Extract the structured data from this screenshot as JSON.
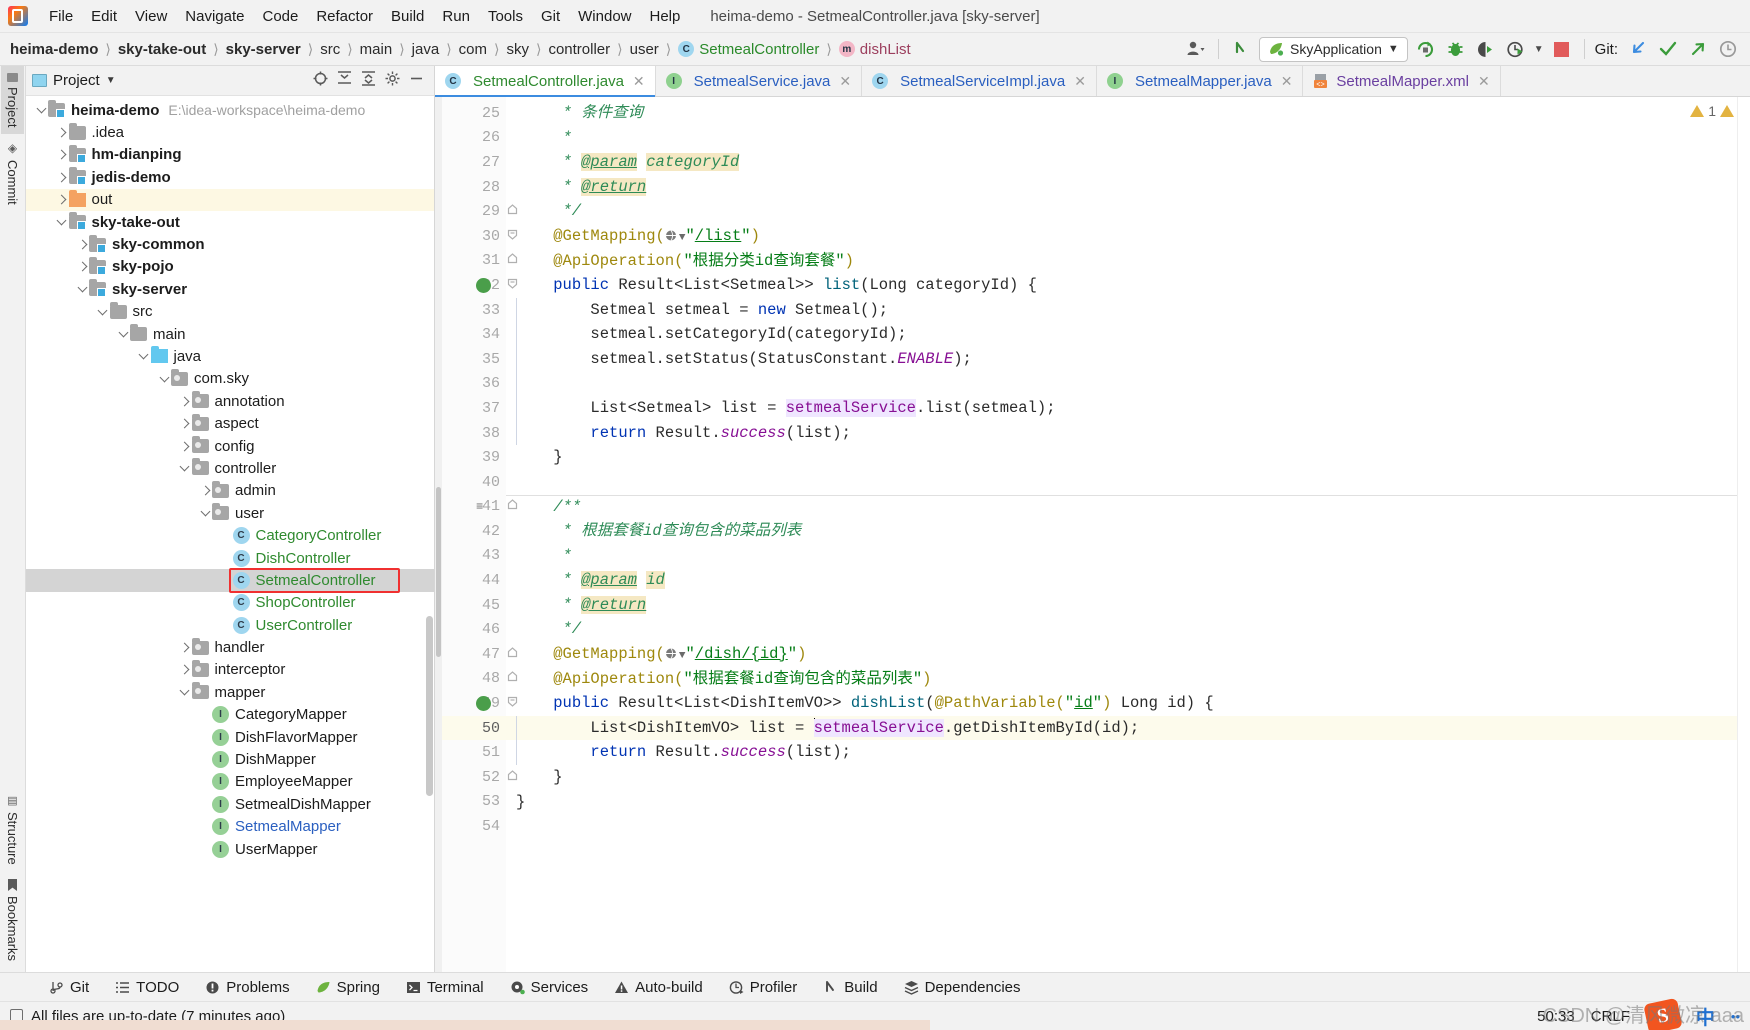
{
  "window": {
    "title": "heima-demo - SetmealController.java [sky-server]"
  },
  "menu": {
    "items": [
      "File",
      "Edit",
      "View",
      "Navigate",
      "Code",
      "Refactor",
      "Build",
      "Run",
      "Tools",
      "Git",
      "Window",
      "Help"
    ]
  },
  "breadcrumb": {
    "items": [
      {
        "label": "heima-demo",
        "bold": true
      },
      {
        "label": "sky-take-out",
        "bold": true
      },
      {
        "label": "sky-server",
        "bold": true
      },
      {
        "label": "src",
        "bold": false
      },
      {
        "label": "main",
        "bold": false
      },
      {
        "label": "java",
        "bold": false
      },
      {
        "label": "com",
        "bold": false
      },
      {
        "label": "sky",
        "bold": false
      },
      {
        "label": "controller",
        "bold": false
      },
      {
        "label": "user",
        "bold": false
      },
      {
        "label": "SetmealController",
        "bold": false,
        "badge": "C",
        "color": "green"
      },
      {
        "label": "dishList",
        "bold": false,
        "badge": "m",
        "color": "pink"
      }
    ]
  },
  "toolbar": {
    "run_config": "SkyApplication",
    "git_label": "Git:",
    "icons": [
      "profiles-icon",
      "back-arrow-icon",
      "run-icon",
      "debug-icon",
      "run-coverage-icon",
      "profiler-run-icon",
      "stop-icon",
      "update-project-icon",
      "commit-icon",
      "push-icon",
      "history-icon"
    ]
  },
  "rail": {
    "top": [
      "Project",
      "Commit"
    ],
    "bottom": [
      "Bookmarks",
      "Structure"
    ]
  },
  "project_panel": {
    "title": "Project",
    "tools": [
      "locate-icon",
      "expand-all-icon",
      "collapse-all-icon",
      "settings-icon",
      "hide-icon"
    ],
    "tree": [
      {
        "depth": 0,
        "label": "heima-demo",
        "path": "E:\\idea-workspace\\heima-demo",
        "icon": "module",
        "twisty": "down",
        "bold": true
      },
      {
        "depth": 1,
        "label": ".idea",
        "icon": "folder",
        "twisty": "right",
        "bold": false
      },
      {
        "depth": 1,
        "label": "hm-dianping",
        "icon": "module",
        "twisty": "right",
        "bold": true
      },
      {
        "depth": 1,
        "label": "jedis-demo",
        "icon": "module",
        "twisty": "right",
        "bold": true
      },
      {
        "depth": 1,
        "label": "out",
        "icon": "folder-orange",
        "twisty": "right",
        "bold": false,
        "highlight": true
      },
      {
        "depth": 1,
        "label": "sky-take-out",
        "icon": "module",
        "twisty": "down",
        "bold": true
      },
      {
        "depth": 2,
        "label": "sky-common",
        "icon": "module",
        "twisty": "right",
        "bold": true
      },
      {
        "depth": 2,
        "label": "sky-pojo",
        "icon": "module",
        "twisty": "right",
        "bold": true
      },
      {
        "depth": 2,
        "label": "sky-server",
        "icon": "module",
        "twisty": "down",
        "bold": true
      },
      {
        "depth": 3,
        "label": "src",
        "icon": "folder",
        "twisty": "down",
        "bold": false
      },
      {
        "depth": 4,
        "label": "main",
        "icon": "folder",
        "twisty": "down",
        "bold": false
      },
      {
        "depth": 5,
        "label": "java",
        "icon": "folder-blue",
        "twisty": "down",
        "bold": false
      },
      {
        "depth": 6,
        "label": "com.sky",
        "icon": "package",
        "twisty": "down",
        "bold": false
      },
      {
        "depth": 7,
        "label": "annotation",
        "icon": "package",
        "twisty": "right",
        "bold": false
      },
      {
        "depth": 7,
        "label": "aspect",
        "icon": "package",
        "twisty": "right",
        "bold": false
      },
      {
        "depth": 7,
        "label": "config",
        "icon": "package",
        "twisty": "right",
        "bold": false
      },
      {
        "depth": 7,
        "label": "controller",
        "icon": "package",
        "twisty": "down",
        "bold": false
      },
      {
        "depth": 8,
        "label": "admin",
        "icon": "package",
        "twisty": "right",
        "bold": false
      },
      {
        "depth": 8,
        "label": "user",
        "icon": "package",
        "twisty": "down",
        "bold": false
      },
      {
        "depth": 9,
        "label": "CategoryController",
        "icon": "class",
        "twisty": "none",
        "bold": false,
        "color": "green"
      },
      {
        "depth": 9,
        "label": "DishController",
        "icon": "class",
        "twisty": "none",
        "bold": false,
        "color": "green"
      },
      {
        "depth": 9,
        "label": "SetmealController",
        "icon": "class",
        "twisty": "none",
        "bold": false,
        "color": "green",
        "selected": true,
        "boxed": true
      },
      {
        "depth": 9,
        "label": "ShopController",
        "icon": "class",
        "twisty": "none",
        "bold": false,
        "color": "green"
      },
      {
        "depth": 9,
        "label": "UserController",
        "icon": "class",
        "twisty": "none",
        "bold": false,
        "color": "green"
      },
      {
        "depth": 7,
        "label": "handler",
        "icon": "package",
        "twisty": "right",
        "bold": false
      },
      {
        "depth": 7,
        "label": "interceptor",
        "icon": "package",
        "twisty": "right",
        "bold": false
      },
      {
        "depth": 7,
        "label": "mapper",
        "icon": "package",
        "twisty": "down",
        "bold": false
      },
      {
        "depth": 8,
        "label": "CategoryMapper",
        "icon": "interface",
        "twisty": "none",
        "bold": false
      },
      {
        "depth": 8,
        "label": "DishFlavorMapper",
        "icon": "interface",
        "twisty": "none",
        "bold": false
      },
      {
        "depth": 8,
        "label": "DishMapper",
        "icon": "interface",
        "twisty": "none",
        "bold": false
      },
      {
        "depth": 8,
        "label": "EmployeeMapper",
        "icon": "interface",
        "twisty": "none",
        "bold": false
      },
      {
        "depth": 8,
        "label": "SetmealDishMapper",
        "icon": "interface",
        "twisty": "none",
        "bold": false
      },
      {
        "depth": 8,
        "label": "SetmealMapper",
        "icon": "interface",
        "twisty": "none",
        "bold": false,
        "color": "blue"
      },
      {
        "depth": 8,
        "label": "UserMapper",
        "icon": "interface",
        "twisty": "none",
        "bold": false
      }
    ]
  },
  "editor": {
    "tabs": [
      {
        "label": "SetmealController.java",
        "badge": "C",
        "color": "green",
        "active": true
      },
      {
        "label": "SetmealService.java",
        "badge": "I",
        "color": "blue",
        "active": false
      },
      {
        "label": "SetmealServiceImpl.java",
        "badge": "C",
        "color": "blue",
        "active": false
      },
      {
        "label": "SetmealMapper.java",
        "badge": "I",
        "color": "blue",
        "active": false
      },
      {
        "label": "SetmealMapper.xml",
        "badge": "X",
        "color": "purple",
        "active": false
      }
    ],
    "warning_count": "1",
    "first_line": 25,
    "current_line": 50,
    "lines": [
      {
        "n": 25,
        "text": "     * 条件查询"
      },
      {
        "n": 26,
        "text": "     *"
      },
      {
        "n": 27,
        "text": "     * @param categoryId"
      },
      {
        "n": 28,
        "text": "     * @return"
      },
      {
        "n": 29,
        "text": "     */"
      },
      {
        "n": 30,
        "text": "    @GetMapping(\"/list\")"
      },
      {
        "n": 31,
        "text": "    @ApiOperation(\"根据分类id查询套餐\")"
      },
      {
        "n": 32,
        "text": "    public Result<List<Setmeal>> list(Long categoryId) {"
      },
      {
        "n": 33,
        "text": "        Setmeal setmeal = new Setmeal();"
      },
      {
        "n": 34,
        "text": "        setmeal.setCategoryId(categoryId);"
      },
      {
        "n": 35,
        "text": "        setmeal.setStatus(StatusConstant.ENABLE);"
      },
      {
        "n": 36,
        "text": ""
      },
      {
        "n": 37,
        "text": "        List<Setmeal> list = setmealService.list(setmeal);"
      },
      {
        "n": 38,
        "text": "        return Result.success(list);"
      },
      {
        "n": 39,
        "text": "    }"
      },
      {
        "n": 40,
        "text": ""
      },
      {
        "n": 41,
        "text": "    /**"
      },
      {
        "n": 42,
        "text": "     * 根据套餐id查询包含的菜品列表"
      },
      {
        "n": 43,
        "text": "     *"
      },
      {
        "n": 44,
        "text": "     * @param id"
      },
      {
        "n": 45,
        "text": "     * @return"
      },
      {
        "n": 46,
        "text": "     */"
      },
      {
        "n": 47,
        "text": "    @GetMapping(\"/dish/{id}\")"
      },
      {
        "n": 48,
        "text": "    @ApiOperation(\"根据套餐id查询包含的菜品列表\")"
      },
      {
        "n": 49,
        "text": "    public Result<List<DishItemVO>> dishList(@PathVariable(\"id\") Long id) {"
      },
      {
        "n": 50,
        "text": "        List<DishItemVO> list = setmealService.getDishItemById(id);"
      },
      {
        "n": 51,
        "text": "        return Result.success(list);"
      },
      {
        "n": 52,
        "text": "    }"
      },
      {
        "n": 53,
        "text": "}"
      },
      {
        "n": 54,
        "text": ""
      }
    ]
  },
  "toolwindows": {
    "items": [
      {
        "label": "Git",
        "icon": "git-icon"
      },
      {
        "label": "TODO",
        "icon": "todo-icon"
      },
      {
        "label": "Problems",
        "icon": "problems-icon"
      },
      {
        "label": "Spring",
        "icon": "spring-icon"
      },
      {
        "label": "Terminal",
        "icon": "terminal-icon"
      },
      {
        "label": "Services",
        "icon": "services-icon"
      },
      {
        "label": "Auto-build",
        "icon": "auto-build-icon"
      },
      {
        "label": "Profiler",
        "icon": "profiler-icon"
      },
      {
        "label": "Build",
        "icon": "build-icon"
      },
      {
        "label": "Dependencies",
        "icon": "dependencies-icon"
      }
    ]
  },
  "statusbar": {
    "message": "All files are up-to-date (7 minutes ago)",
    "caret": "50:33",
    "line_separator": "CRLF",
    "ime_language": "中",
    "watermark": "CSDN @清风微凉 aaa"
  }
}
